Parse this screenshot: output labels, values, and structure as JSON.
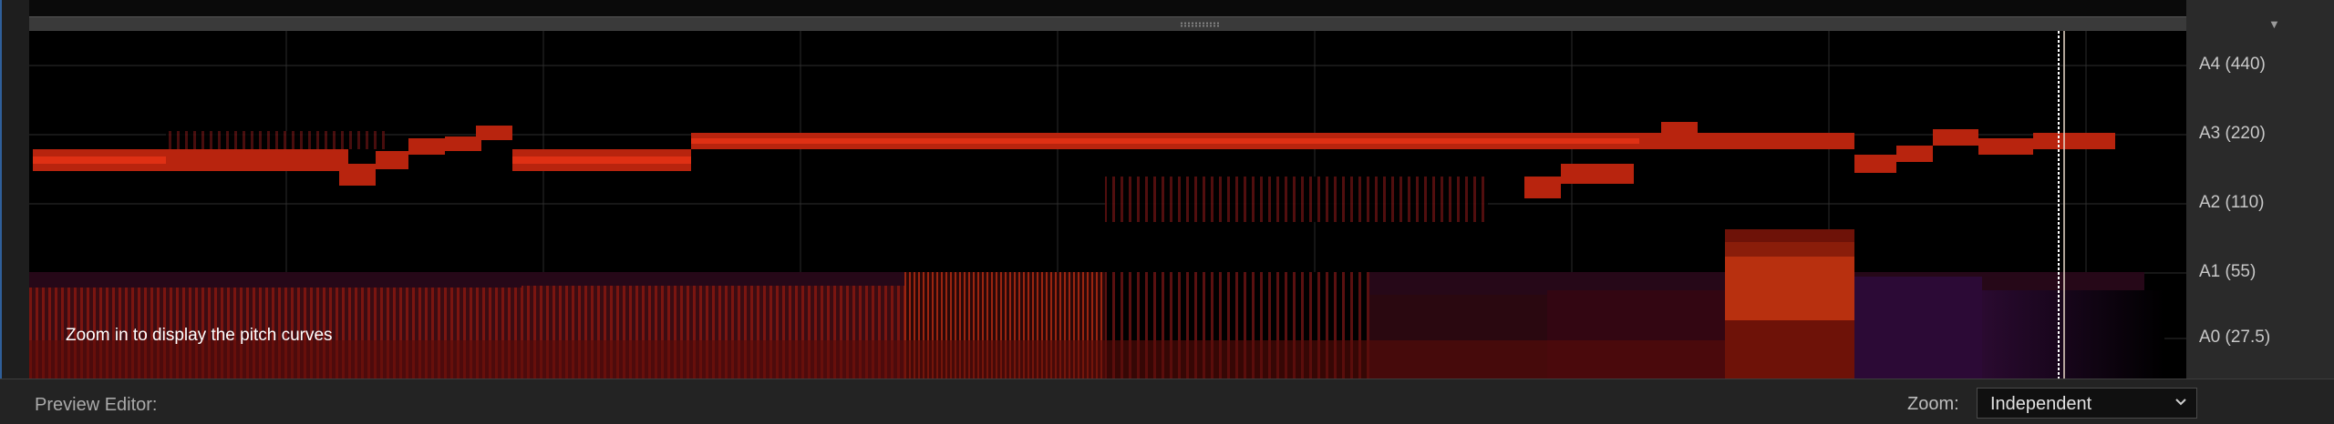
{
  "panel": {
    "overlay_message": "Zoom in to display the pitch curves",
    "collapse_icon": "collapse-arrow-icon"
  },
  "pitch_ruler": {
    "labels": [
      "A4 (440)",
      "A3 (220)",
      "A2 (110)",
      "A1 (55)",
      "A0 (27.5)"
    ]
  },
  "footer": {
    "preview_editor_label": "Preview Editor:",
    "zoom_label": "Zoom:",
    "zoom_value": "Independent"
  },
  "colors": {
    "accent_blue": "#2f5f9a",
    "playhead": "#ffffff",
    "spectral_red": "#d0200e",
    "spectral_purple": "#3a0a3e"
  }
}
